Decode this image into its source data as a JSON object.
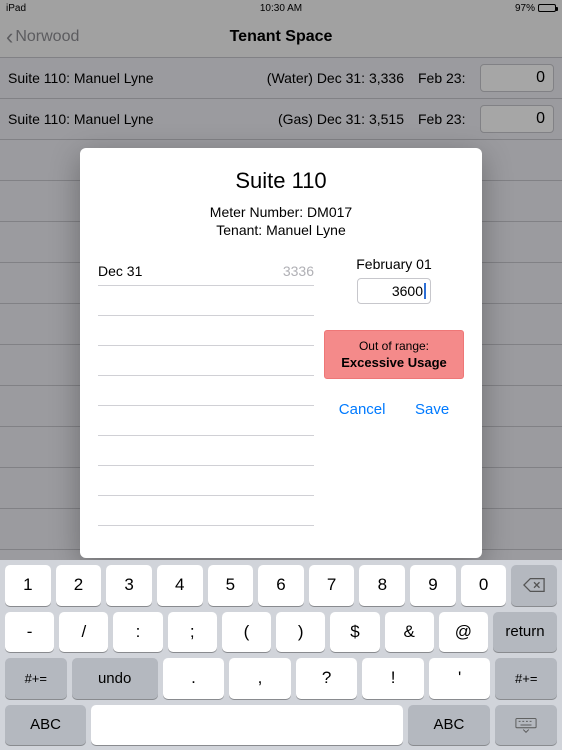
{
  "statusbar": {
    "device": "iPad",
    "time": "10:30 AM",
    "battery_pct": "97%"
  },
  "nav": {
    "back": "Norwood",
    "title": "Tenant Space"
  },
  "rows": [
    {
      "name": "Suite 110: Manuel Lyne",
      "mid": "(Water) Dec 31: 3,336",
      "date2": "Feb 23:",
      "value": "0"
    },
    {
      "name": "Suite 110: Manuel Lyne",
      "mid": "(Gas) Dec 31: 3,515",
      "date2": "Feb 23:",
      "value": "0"
    }
  ],
  "modal": {
    "title": "Suite 110",
    "meter_label": "Meter Number: DM017",
    "tenant_label": "Tenant: Manuel Lyne",
    "prev_date": "Dec 31",
    "prev_value": "3336",
    "new_date": "February 01",
    "new_value": "3600",
    "warn_line1": "Out of range:",
    "warn_line2": "Excessive Usage",
    "cancel": "Cancel",
    "save": "Save"
  },
  "keyboard": {
    "row1": [
      "1",
      "2",
      "3",
      "4",
      "5",
      "6",
      "7",
      "8",
      "9",
      "0"
    ],
    "row2": [
      "-",
      "/",
      ":",
      ";",
      "(",
      ")",
      "$",
      "&",
      "@"
    ],
    "return": "return",
    "side": "#+=",
    "undo": "undo",
    "row3": [
      ".",
      ",",
      "?",
      "!",
      "'"
    ],
    "abc": "ABC"
  }
}
